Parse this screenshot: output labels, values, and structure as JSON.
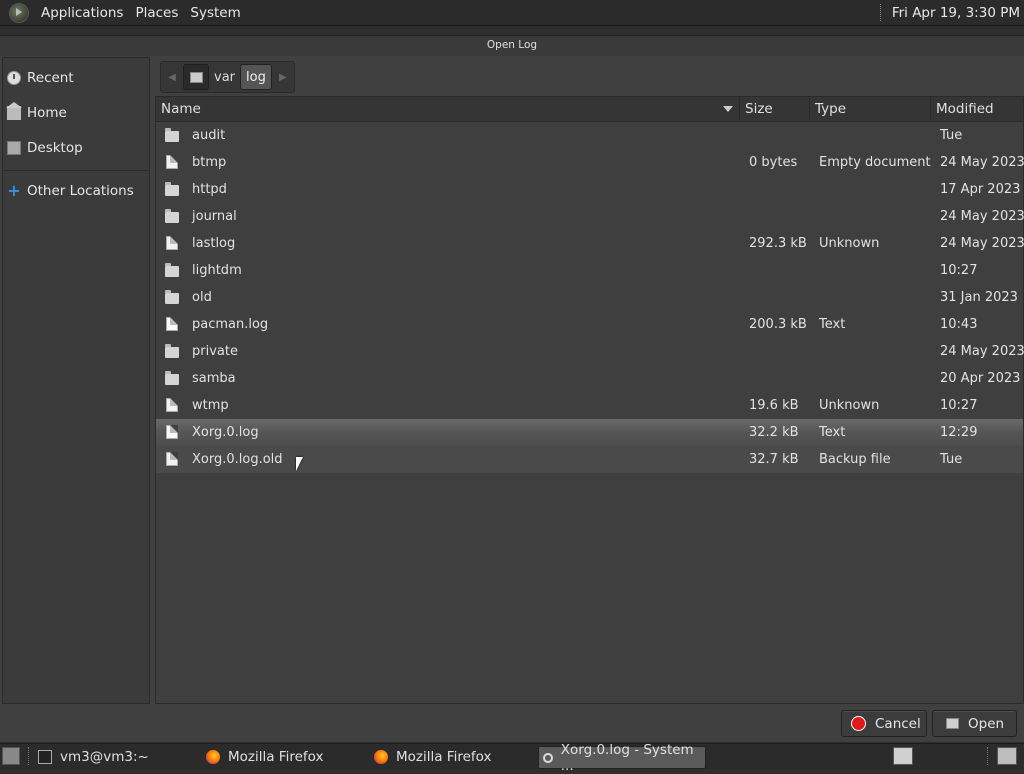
{
  "top_panel": {
    "menus": [
      "Applications",
      "Places",
      "System"
    ],
    "clock": "Fri Apr 19,  3:30 PM"
  },
  "dialog": {
    "title": "Open Log",
    "cancel_label": "Cancel",
    "open_label": "Open"
  },
  "sidebar": {
    "items": [
      {
        "label": "Recent",
        "icon": "clock-icon"
      },
      {
        "label": "Home",
        "icon": "home-icon"
      },
      {
        "label": "Desktop",
        "icon": "desktop-icon"
      },
      {
        "label": "Other Locations",
        "icon": "plus-icon"
      }
    ]
  },
  "pathbar": {
    "segments": [
      "var",
      "log"
    ]
  },
  "filelist": {
    "columns": {
      "name": "Name",
      "size": "Size",
      "type": "Type",
      "modified": "Modified"
    },
    "rows": [
      {
        "name": "audit",
        "size": "",
        "type": "",
        "modified": "Tue",
        "kind": "folder"
      },
      {
        "name": "btmp",
        "size": "0 bytes",
        "type": "Empty document",
        "modified": "24 May 2023",
        "kind": "file"
      },
      {
        "name": "httpd",
        "size": "",
        "type": "",
        "modified": "17 Apr 2023",
        "kind": "folder"
      },
      {
        "name": "journal",
        "size": "",
        "type": "",
        "modified": "24 May 2023",
        "kind": "folder"
      },
      {
        "name": "lastlog",
        "size": "292.3 kB",
        "type": "Unknown",
        "modified": "24 May 2023",
        "kind": "file"
      },
      {
        "name": "lightdm",
        "size": "",
        "type": "",
        "modified": "10:27",
        "kind": "folder"
      },
      {
        "name": "old",
        "size": "",
        "type": "",
        "modified": "31 Jan 2023",
        "kind": "folder"
      },
      {
        "name": "pacman.log",
        "size": "200.3 kB",
        "type": "Text",
        "modified": "10:43",
        "kind": "text"
      },
      {
        "name": "private",
        "size": "",
        "type": "",
        "modified": "24 May 2023",
        "kind": "folder"
      },
      {
        "name": "samba",
        "size": "",
        "type": "",
        "modified": "20 Apr 2023",
        "kind": "folder"
      },
      {
        "name": "wtmp",
        "size": "19.6 kB",
        "type": "Unknown",
        "modified": "10:27",
        "kind": "file"
      },
      {
        "name": "Xorg.0.log",
        "size": "32.2 kB",
        "type": "Text",
        "modified": "12:29",
        "kind": "text",
        "state": "selected"
      },
      {
        "name": "Xorg.0.log.old",
        "size": "32.7 kB",
        "type": "Backup file",
        "modified": "Tue",
        "kind": "file",
        "state": "hover"
      }
    ]
  },
  "taskbar": {
    "tasks": [
      {
        "label": "vm3@vm3:~",
        "icon": "terminal-icon"
      },
      {
        "label": "Mozilla Firefox",
        "icon": "firefox-icon"
      },
      {
        "label": "Mozilla Firefox",
        "icon": "firefox-icon"
      },
      {
        "label": "Xorg.0.log - System ...",
        "icon": "log-viewer-icon",
        "active": true
      }
    ]
  }
}
